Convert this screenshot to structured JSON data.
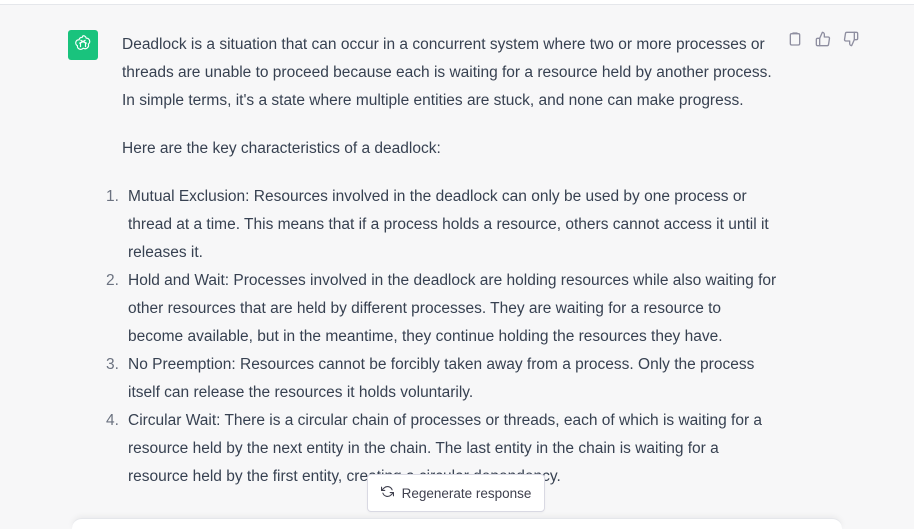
{
  "assistant": {
    "avatar_icon": "openai-logo-icon",
    "avatar_color": "#19c37d"
  },
  "message": {
    "intro": "Deadlock is a situation that can occur in a concurrent system where two or more processes or threads are unable to proceed because each is waiting for a resource held by another process. In simple terms, it's a state where multiple entities are stuck, and none can make progress.",
    "lead": "Here are the key characteristics of a deadlock:",
    "items": [
      {
        "num": "1.",
        "text": "Mutual Exclusion: Resources involved in the deadlock can only be used by one process or thread at a time. This means that if a process holds a resource, others cannot access it until it releases it."
      },
      {
        "num": "2.",
        "text": "Hold and Wait: Processes involved in the deadlock are holding resources while also waiting for other resources that are held by different processes. They are waiting for a resource to become available, but in the meantime, they continue holding the resources they have."
      },
      {
        "num": "3.",
        "text": "No Preemption: Resources cannot be forcibly taken away from a process. Only the process itself can release the resources it holds voluntarily."
      },
      {
        "num": "4.",
        "text": "Circular Wait: There is a circular chain of processes or threads, each of which is waiting for a resource held by the next entity in the chain. The last entity in the chain is waiting for a resource held by the first entity, creating a circular dependency."
      }
    ]
  },
  "actions": {
    "copy_icon": "clipboard-icon",
    "like_icon": "thumbs-up-icon",
    "dislike_icon": "thumbs-down-icon"
  },
  "regenerate": {
    "label": "Regenerate response",
    "icon": "refresh-icon"
  }
}
